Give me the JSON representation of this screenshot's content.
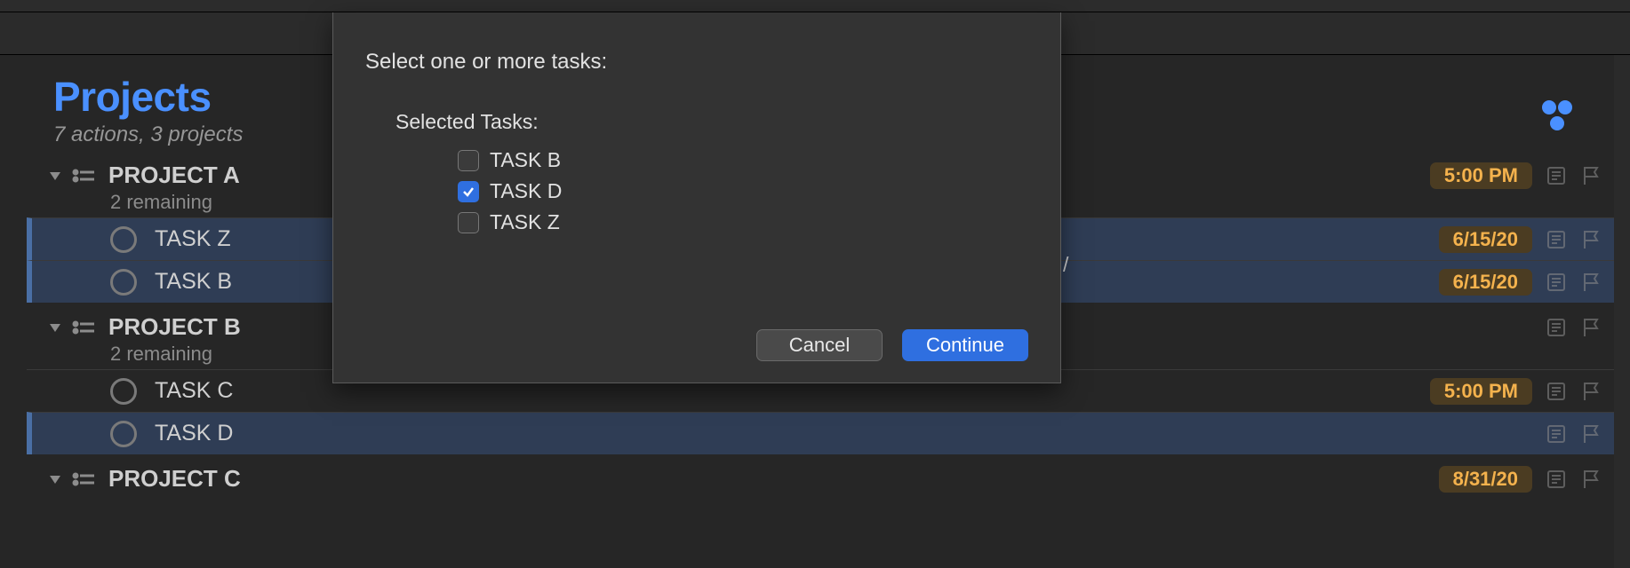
{
  "header": {
    "title": "Projects",
    "subtitle": "7 actions, 3 projects"
  },
  "projects": [
    {
      "name": "PROJECT A",
      "remaining": "2 remaining",
      "header_due": "5:00 PM",
      "tasks": [
        {
          "title": "TASK Z",
          "due": "6/15/20",
          "selected": true,
          "behind_frag": "/"
        },
        {
          "title": "TASK B",
          "due": "6/15/20",
          "selected": true
        }
      ]
    },
    {
      "name": "PROJECT B",
      "remaining": "2 remaining",
      "header_due": "",
      "tasks": [
        {
          "title": "TASK C",
          "due": "5:00 PM",
          "selected": false
        },
        {
          "title": "TASK D",
          "due": "",
          "selected": true
        }
      ]
    },
    {
      "name": "PROJECT C",
      "remaining": "",
      "header_due": "",
      "partial_date": "8/31/20",
      "tasks": []
    }
  ],
  "dialog": {
    "prompt": "Select one or more tasks:",
    "section_label": "Selected Tasks:",
    "options": [
      {
        "label": "TASK B",
        "checked": false
      },
      {
        "label": "TASK D",
        "checked": true
      },
      {
        "label": "TASK Z",
        "checked": false
      }
    ],
    "cancel_label": "Cancel",
    "continue_label": "Continue"
  }
}
